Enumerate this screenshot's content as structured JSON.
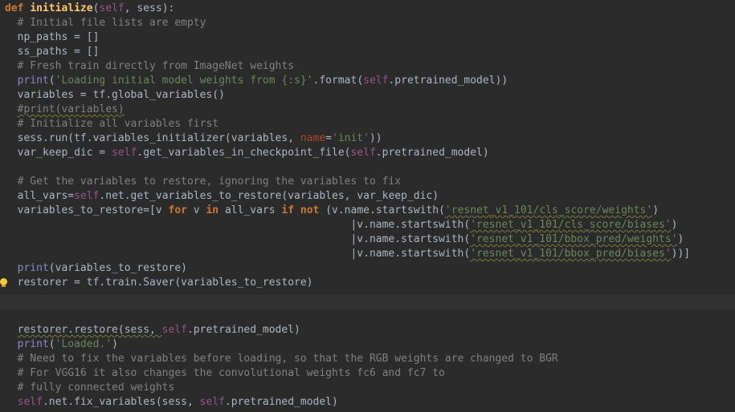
{
  "editor": {
    "lines": {
      "l01": {
        "def": "def",
        "name": "initialize",
        "open": "(",
        "self": "self",
        "rest": ", sess):"
      },
      "l02": {
        "comment": "# Initial file lists are empty"
      },
      "l03": {
        "code": "np_paths = []"
      },
      "l04": {
        "code": "ss_paths = []"
      },
      "l05": {
        "comment": "# Fresh train directly from ImageNet weights"
      },
      "l06": {
        "print": "print",
        "open": "(",
        "str": "'Loading initial model weights from {:s}'",
        "mid": ".format(",
        "self": "self",
        "rest": ".pretrained_model))"
      },
      "l07": {
        "code": "variables = tf.global_variables()"
      },
      "l08": {
        "comment": "#print(variables)"
      },
      "l09": {
        "comment": "# Initialize all variables first"
      },
      "l10": {
        "pre": "sess.run(tf.variables_initializer(variables, ",
        "kw": "name",
        "eq": "=",
        "str": "'init'",
        "rest": "))"
      },
      "l11": {
        "pre": "var_keep_dic = ",
        "self": "self",
        "rest": ".get_variables_in_checkpoint_file(",
        "self2": "self",
        "rest2": ".pretrained_model)"
      },
      "l13": {
        "comment": "# Get the variables to restore, ignoring the variables to fix"
      },
      "l14": {
        "pre": "all_vars=",
        "self": "self",
        "rest": ".net.get_variables_to_restore(variables, var_keep_dic)"
      },
      "l15": {
        "pre": "variables_to_restore=[v ",
        "for": "for",
        "mid1": " v ",
        "in": "in",
        "mid2": " all_vars ",
        "if": "if",
        "sp": " ",
        "not": "not",
        "mid3": " (v.name.startswith(",
        "str": "'resnet_v1_101/cls_score/weights'",
        "rest": ")"
      },
      "l16": {
        "pre": "|v.name.startswith(",
        "str": "'resnet_v1_101/cls_score/biases'",
        "rest": ")"
      },
      "l17": {
        "pre": "|v.name.startswith(",
        "str": "'resnet_v1_101/bbox_pred/weights'",
        "rest": ")"
      },
      "l18": {
        "pre": "|v.name.startswith(",
        "str": "'resnet_v1_101/bbox_pred/biases'",
        "rest": "))]"
      },
      "l19": {
        "print": "print",
        "rest": "(variables_to_restore)"
      },
      "l20": {
        "code": "restorer = tf.train.Saver(variables_to_restore)"
      },
      "l23": {
        "pre": "restorer.restore(sess, ",
        "self": "self",
        "rest": ".pretrained_model)"
      },
      "l24": {
        "print": "print",
        "open": "(",
        "str": "'Loaded.'",
        "rest": ")"
      },
      "l25": {
        "comment": "# Need to fix the variables before loading, so that the RGB weights are changed to BGR"
      },
      "l26": {
        "comment": "# For VGG16 it also changes the convolutional weights fc6 and fc7 to"
      },
      "l27": {
        "comment": "# fully connected weights"
      },
      "l28": {
        "self": "self",
        "rest": ".net.fix_variables(sess, ",
        "self2": "self",
        "rest2": ".pretrained_model)"
      }
    },
    "colors": {
      "background": "#2b2b2b",
      "keyword": "#cc7832",
      "function": "#ffc66d",
      "self": "#94558d",
      "string": "#6a8759",
      "comment": "#808080"
    },
    "gutter_icon": "lightbulb-icon"
  }
}
